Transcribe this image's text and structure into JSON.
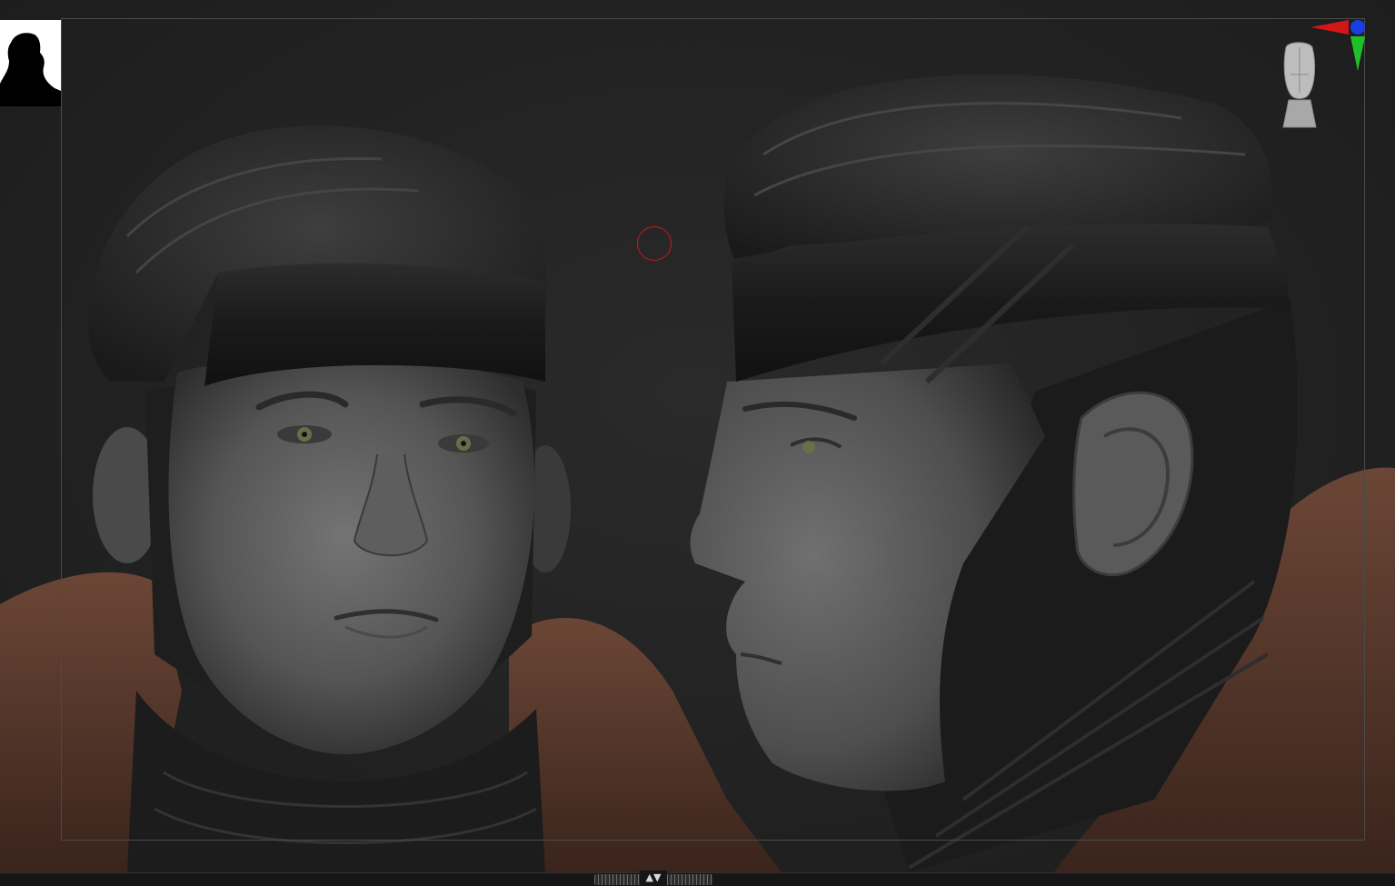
{
  "app": {
    "name": "",
    "view": "3d-viewport"
  },
  "viewport": {
    "background_color": "#242424",
    "frame_color": "#4a4a4a",
    "brush_cursor_color": "#c01c1c"
  },
  "scene": {
    "subjects": [
      "head-front-view",
      "head-side-view"
    ],
    "materials": {
      "skin": "#5a5a5a",
      "headband": "#1d1d1d",
      "hair": "#2b2b2b",
      "collar": "#5a3a2e"
    }
  },
  "icons": {
    "silhouette": "silhouette-icon",
    "nav_head": "nav-head-icon",
    "axis": "axis-gizmo-icon",
    "tray": "tray-toggle-icon"
  },
  "axis_colors": {
    "x": "#d41616",
    "y": "#1fbf2a",
    "z": "#1a3fe0"
  },
  "bottom_tray": {
    "toggle_label": "▲▼"
  }
}
